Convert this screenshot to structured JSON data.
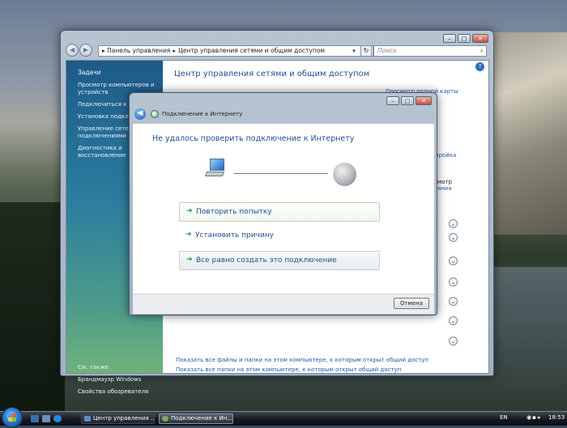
{
  "control_panel": {
    "address_root": "Панель управления",
    "address_leaf": "Центр управления сетями и общим доступом",
    "search_placeholder": "Поиск",
    "title": "Центр управления сетями и общим доступом",
    "link_full_map": "Просмотр полной карты",
    "partial_link_1": "пройка",
    "partial_link_2": "мотр",
    "partial_link_3": "яния",
    "tasks_header": "Задачи",
    "tasks": [
      "Просмотр компьютеров и устройств",
      "Подключиться к се",
      "Установка подключ сети",
      "Управление сетевы подключениями",
      "Диагностика и восстановление"
    ],
    "see_also_header": "См. также",
    "see_also": [
      "Брандмауэр Windows",
      "Свойства обозревателя"
    ],
    "bottom_links": [
      "Показать все файлы и папки на этом компьютере, к которым открыт общий доступ",
      "Показать все папки на этом компьютере, к которым открыт общий доступ"
    ]
  },
  "dialog": {
    "title": "Подключение к Интернету",
    "heading": "Не удалось проверить подключение к Интернету",
    "options": [
      "Повторить попытку",
      "Установить причину",
      "Все равно создать это подключение"
    ],
    "cancel_label": "Отмена"
  },
  "taskbar": {
    "buttons": [
      "Центр управления ...",
      "Подключение к Ин..."
    ],
    "language": "EN",
    "clock": "18:53"
  },
  "icons": {
    "back": "back-arrow-icon",
    "forward": "forward-arrow-icon",
    "search": "magnifier-icon",
    "help": "help-icon",
    "computer": "computer-icon",
    "globe": "internet-globe-icon",
    "option_arrow": "green-arrow-icon"
  },
  "colors": {
    "link_blue": "#1f59b5",
    "heading_blue": "#1f4e92",
    "option_arrow_green": "#1a9a28"
  }
}
